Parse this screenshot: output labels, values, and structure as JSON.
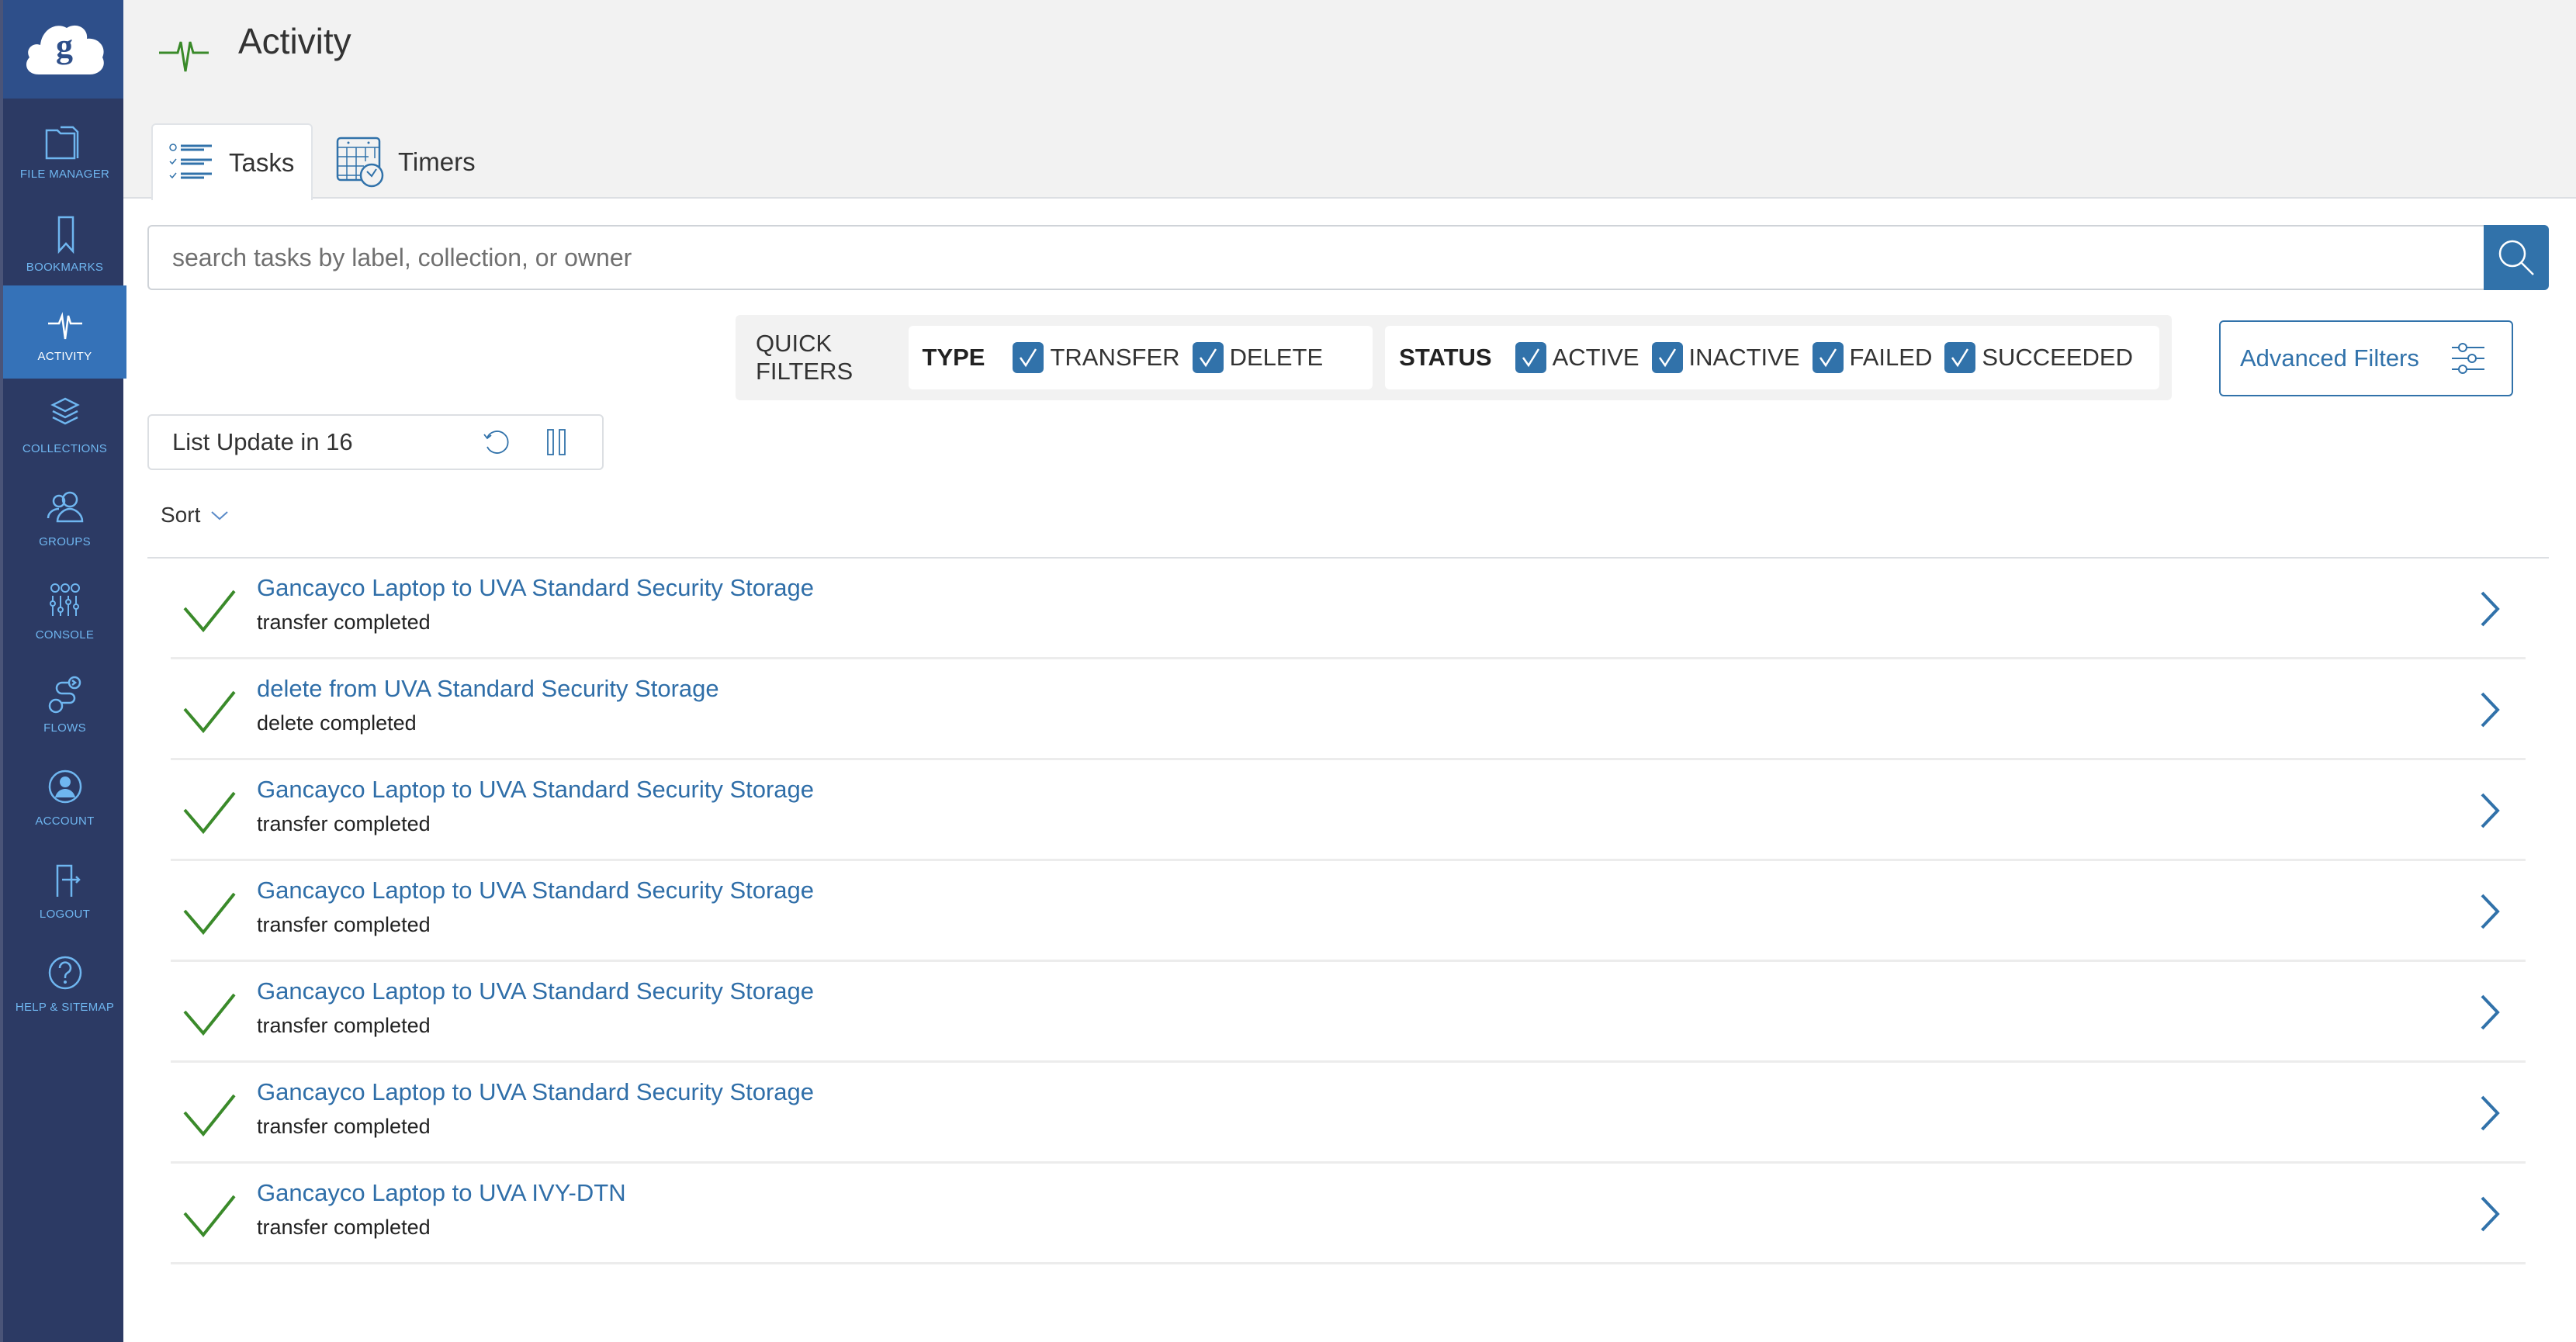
{
  "sidebar": {
    "logo_name": "globus",
    "items": [
      {
        "label": "File Manager",
        "icon": "folder-icon",
        "active": false
      },
      {
        "label": "Bookmarks",
        "icon": "bookmark-icon",
        "active": false
      },
      {
        "label": "Activity",
        "icon": "activity-pulse-icon",
        "active": true
      },
      {
        "label": "Collections",
        "icon": "layers-icon",
        "active": false
      },
      {
        "label": "Groups",
        "icon": "users-icon",
        "active": false
      },
      {
        "label": "Console",
        "icon": "console-sliders-icon",
        "active": false
      },
      {
        "label": "Flows",
        "icon": "flows-icon",
        "active": false
      },
      {
        "label": "Account",
        "icon": "account-icon",
        "active": false
      },
      {
        "label": "Logout",
        "icon": "logout-icon",
        "active": false
      },
      {
        "label": "Help & Sitemap",
        "icon": "help-icon",
        "active": false
      }
    ]
  },
  "header": {
    "title": "Activity",
    "tabs": [
      {
        "label": "Tasks",
        "active": true
      },
      {
        "label": "Timers",
        "active": false
      }
    ]
  },
  "search": {
    "placeholder": "search tasks by label, collection, or owner",
    "value": ""
  },
  "quick_filters": {
    "label": "QUICK FILTERS",
    "type": {
      "title": "TYPE",
      "options": [
        {
          "label": "TRANSFER",
          "checked": true
        },
        {
          "label": "DELETE",
          "checked": true
        }
      ]
    },
    "status": {
      "title": "STATUS",
      "options": [
        {
          "label": "ACTIVE",
          "checked": true
        },
        {
          "label": "INACTIVE",
          "checked": true
        },
        {
          "label": "FAILED",
          "checked": true
        },
        {
          "label": "SUCCEEDED",
          "checked": true
        }
      ]
    },
    "advanced_label": "Advanced Filters"
  },
  "list_update": {
    "text": "List Update in 16"
  },
  "sort": {
    "label": "Sort"
  },
  "colors": {
    "accent": "#3172aa",
    "success": "#3a8a2a",
    "sidebar_bg": "#2c3a64",
    "sidebar_active": "#3572b8"
  },
  "tasks": [
    {
      "title": "Gancayco Laptop to UVA Standard Security Storage",
      "status": "transfer completed"
    },
    {
      "title": "delete from UVA Standard Security Storage",
      "status": "delete completed"
    },
    {
      "title": "Gancayco Laptop to UVA Standard Security Storage",
      "status": "transfer completed"
    },
    {
      "title": "Gancayco Laptop to UVA Standard Security Storage",
      "status": "transfer completed"
    },
    {
      "title": "Gancayco Laptop to UVA Standard Security Storage",
      "status": "transfer completed"
    },
    {
      "title": "Gancayco Laptop to UVA Standard Security Storage",
      "status": "transfer completed"
    },
    {
      "title": "Gancayco Laptop to UVA IVY-DTN",
      "status": "transfer completed"
    }
  ]
}
